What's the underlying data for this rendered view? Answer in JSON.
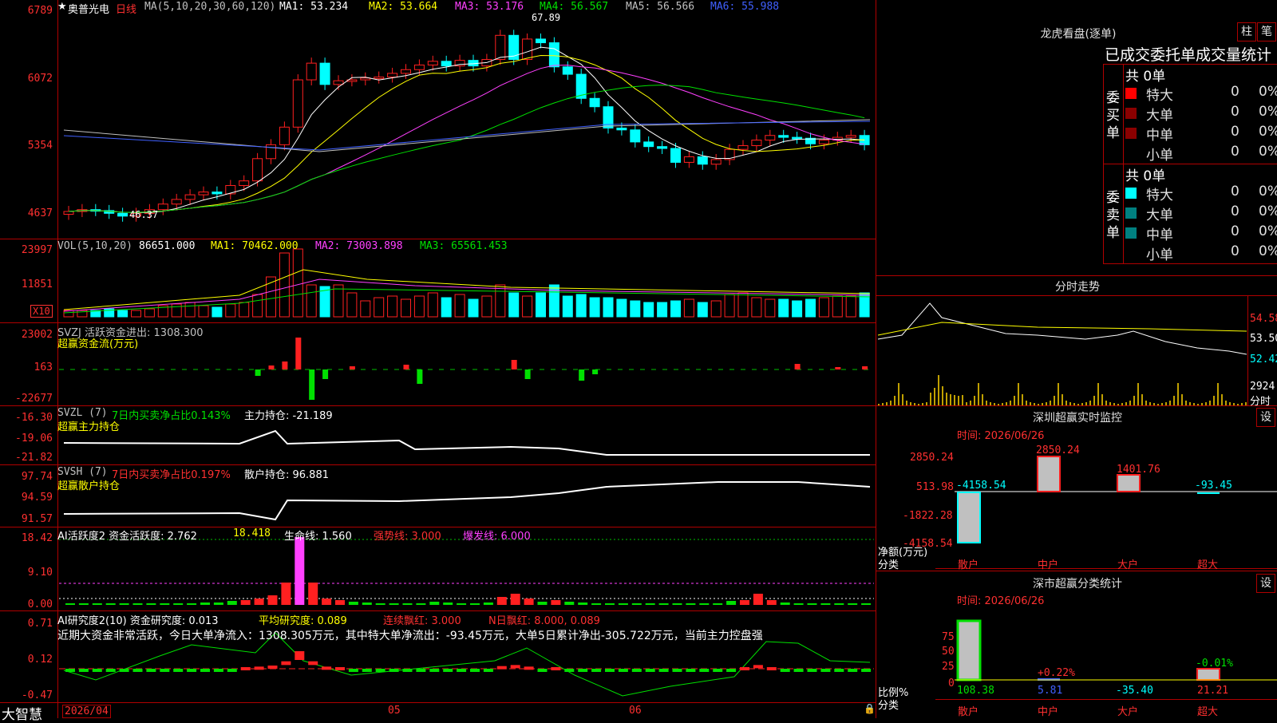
{
  "stock": {
    "name": "奥普光电",
    "period": "日线",
    "ma_label": "MA(5,10,20,30,60,120)",
    "ma1": "MA1: 53.234",
    "ma2": "MA2: 53.664",
    "ma3": "MA3: 53.176",
    "ma4": "MA4: 56.567",
    "ma5": "MA5: 56.566",
    "ma6": "MA6: 55.988",
    "high_mark": "67.89",
    "low_mark": "46.37",
    "y_labels": [
      "6789",
      "6072",
      "5354",
      "4637"
    ]
  },
  "vol": {
    "label": "VOL(5,10,20)",
    "value": "86651.000",
    "ma1": "MA1: 70462.000",
    "ma2": "MA2: 73003.898",
    "ma3": "MA3: 65561.453",
    "y_labels": [
      "23997",
      "11851"
    ],
    "unit": "X10"
  },
  "svzj": {
    "label": "SVZJ  活跃资金进出: 1308.300",
    "subtitle": "超赢资金流(万元)",
    "y_labels": [
      "23002",
      "163",
      "-22677"
    ]
  },
  "svzl": {
    "label": "SVZL (7)",
    "pct": "7日内买卖净占比0.143%",
    "hold": "主力持仓: -21.189",
    "subtitle": "超赢主力持仓",
    "y_labels": [
      "-16.30",
      "-19.06",
      "-21.82"
    ]
  },
  "svsh": {
    "label": "SVSH (7)",
    "pct": "7日内买卖净占比0.197%",
    "hold": "散户持仓: 96.881",
    "subtitle": "超赢散户持仓",
    "y_labels": [
      "97.74",
      "94.59",
      "91.57"
    ]
  },
  "ai_active": {
    "label": "AI活跃度2 资金活跃度: 2.762",
    "v2": "18.418",
    "life": "生命线: 1.560",
    "strong": "强势线: 3.000",
    "burst": "爆发线: 6.000",
    "y_labels": [
      "18.42",
      "9.10",
      "0.00"
    ]
  },
  "ai_research": {
    "label": "AI研究度2(10) 资金研究度: 0.013",
    "avg": "平均研究度: 0.089",
    "cont": "连续飘红: 3.000",
    "n": "N日飘红: 8.000, 0.089",
    "comment": "近期大资金非常活跃，今日大单净流入：1308.305万元，其中特大单净流出：-93.45万元，大单5日累计净出-305.722万元，当前主力控盘强",
    "y_labels": [
      "0.71",
      "0.12",
      "-0.47"
    ]
  },
  "dates": [
    "2026/04",
    "05",
    "06"
  ],
  "brand": "大智慧",
  "right": {
    "dragon_title": "龙虎看盘(逐单)",
    "btn_zhu": "柱",
    "btn_bi": "笔",
    "stat_header": "已成交委托单成交量统计",
    "buy_total": "共 0单",
    "sell_total": "共 0单",
    "buy_label": "委买单",
    "sell_label": "委卖单",
    "rows": [
      {
        "name": "特大",
        "val": "0",
        "pct": "0%"
      },
      {
        "name": "大单",
        "val": "0",
        "pct": "0%"
      },
      {
        "name": "中单",
        "val": "0",
        "pct": "0%"
      },
      {
        "name": "小单",
        "val": "0",
        "pct": "0%"
      }
    ],
    "minute_title": "分时走势",
    "minute_prices": [
      "54.58",
      "53.50",
      "52.42"
    ],
    "minute_vol": "2924",
    "minute_unit": "分时",
    "sz_title": "深圳超赢实时监控",
    "sz_date": "时间: 2026/06/26",
    "sz_y": [
      "2850.24",
      "513.98",
      "-1822.28",
      "-4158.54"
    ],
    "sz_vals": [
      "-4158.54",
      "2850.24",
      "1401.76",
      "-93.45"
    ],
    "sz_unit": "净额(万元)",
    "cats": [
      "散户",
      "中户",
      "大户",
      "超大"
    ],
    "cls_label": "分类",
    "cls_title": "深市超赢分类统计",
    "cls_date": "时间: 2026/06/26",
    "cls_y": [
      "75",
      "50",
      "25",
      "0"
    ],
    "cls_bars": [
      "108.38",
      "5.81",
      "-35.40",
      "21.21"
    ],
    "cls_tops": [
      "+0.22%",
      "-0.01%"
    ],
    "ratio_label": "比例%",
    "set": "设"
  },
  "colors": {
    "up": "#ff2020",
    "down": "#00ffff",
    "grid": "#b00000"
  }
}
